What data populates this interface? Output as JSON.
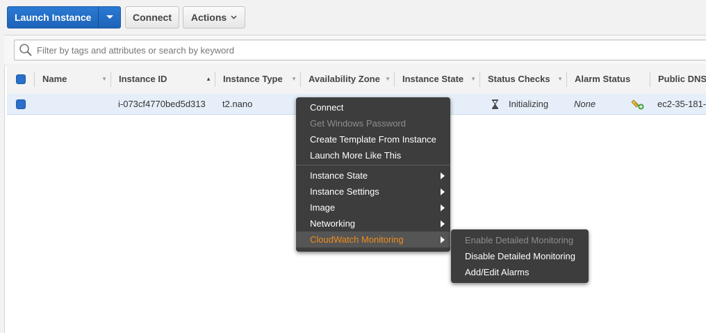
{
  "toolbar": {
    "launch_label": "Launch Instance",
    "connect_label": "Connect",
    "actions_label": "Actions"
  },
  "filter": {
    "placeholder": "Filter by tags and attributes or search by keyword"
  },
  "table": {
    "columns": [
      "Name",
      "Instance ID",
      "Instance Type",
      "Availability Zone",
      "Instance State",
      "Status Checks",
      "Alarm Status",
      "Public DNS"
    ],
    "rows": [
      {
        "name": "",
        "instance_id": "i-073cf4770bed5d313",
        "instance_type": "t2.nano",
        "status_checks": "Initializing",
        "alarm_status": "None",
        "public_dns": "ec2-35-181-"
      }
    ]
  },
  "context_menu": {
    "items": [
      {
        "label": "Connect",
        "disabled": false
      },
      {
        "label": "Get Windows Password",
        "disabled": true
      },
      {
        "label": "Create Template From Instance",
        "disabled": false
      },
      {
        "label": "Launch More Like This",
        "disabled": false
      },
      {
        "label": "Instance State",
        "submenu": true
      },
      {
        "label": "Instance Settings",
        "submenu": true
      },
      {
        "label": "Image",
        "submenu": true
      },
      {
        "label": "Networking",
        "submenu": true
      },
      {
        "label": "CloudWatch Monitoring",
        "submenu": true,
        "active": true
      }
    ]
  },
  "submenu": {
    "items": [
      {
        "label": "Enable Detailed Monitoring",
        "disabled": true
      },
      {
        "label": "Disable Detailed Monitoring",
        "disabled": false
      },
      {
        "label": "Add/Edit Alarms",
        "disabled": false
      }
    ]
  },
  "colors": {
    "primary_button": "#1d63b8",
    "menu_bg": "#3d3d3d",
    "menu_active": "#f08c1a",
    "row_selected": "#e6eef9",
    "checkbox": "#2a6fc9"
  },
  "icons": {
    "search": "search-icon",
    "status_pending": "hourglass-icon",
    "add_alarm": "add-alarm-icon"
  }
}
